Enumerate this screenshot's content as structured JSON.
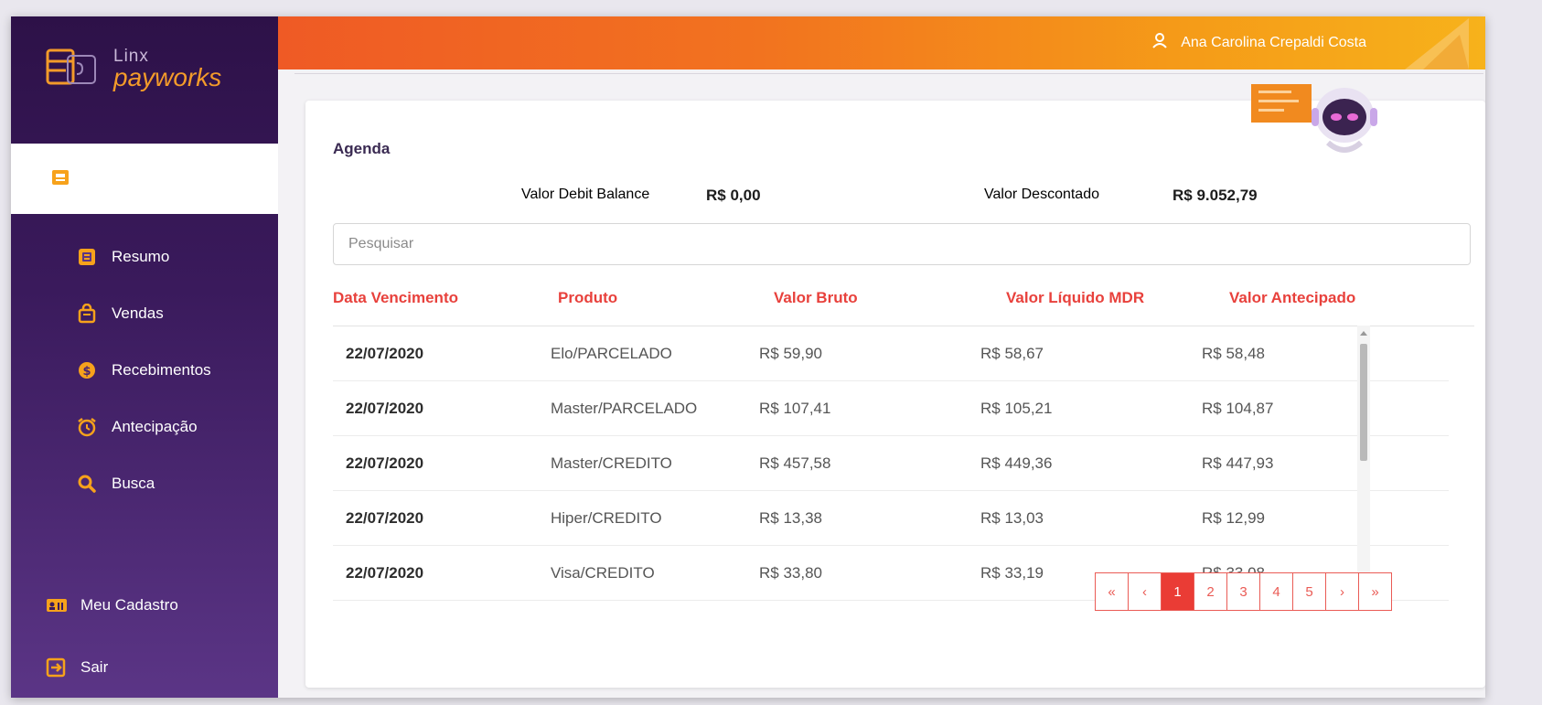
{
  "app": {
    "logo_top": "Linx",
    "logo_bottom": "payworks"
  },
  "header": {
    "user_name": "Ana Carolina Crepaldi Costa"
  },
  "sidebar": {
    "items": [
      {
        "label": "Resumo",
        "icon": "resumo-icon"
      },
      {
        "label": "Vendas",
        "icon": "shopping-bag-icon"
      },
      {
        "label": "Recebimentos",
        "icon": "dollar-coin-icon"
      },
      {
        "label": "Antecipação",
        "icon": "alarm-clock-icon"
      },
      {
        "label": "Busca",
        "icon": "search-icon"
      }
    ],
    "bottom_items": [
      {
        "label": "Meu Cadastro",
        "icon": "id-card-icon"
      },
      {
        "label": "Sair",
        "icon": "logout-icon"
      }
    ]
  },
  "agenda": {
    "title": "Agenda",
    "debit_balance_label": "Valor Debit Balance",
    "debit_balance_value": "R$ 0,00",
    "descontado_label": "Valor Descontado",
    "descontado_value": "R$ 9.052,79",
    "search_placeholder": "Pesquisar"
  },
  "table": {
    "columns": [
      "Data Vencimento",
      "Produto",
      "Valor Bruto",
      "Valor Líquido MDR",
      "Valor Antecipado"
    ],
    "rows": [
      [
        "22/07/2020",
        "Elo/PARCELADO",
        "R$ 59,90",
        "R$ 58,67",
        "R$ 58,48"
      ],
      [
        "22/07/2020",
        "Master/PARCELADO",
        "R$ 107,41",
        "R$ 105,21",
        "R$ 104,87"
      ],
      [
        "22/07/2020",
        "Master/CREDITO",
        "R$ 457,58",
        "R$ 449,36",
        "R$ 447,93"
      ],
      [
        "22/07/2020",
        "Hiper/CREDITO",
        "R$ 13,38",
        "R$ 13,03",
        "R$ 12,99"
      ],
      [
        "22/07/2020",
        "Visa/CREDITO",
        "R$ 33,80",
        "R$ 33,19",
        "R$ 33,08"
      ]
    ]
  },
  "pagination": {
    "first": "«",
    "prev": "‹",
    "pages": [
      "1",
      "2",
      "3",
      "4",
      "5"
    ],
    "active_page": "1",
    "next": "›",
    "last": "»"
  },
  "colors": {
    "sidebar_top": "#2d1148",
    "sidebar_bottom": "#5b3586",
    "header_start": "#ef5a25",
    "header_end": "#f7b21b",
    "accent_red": "#e8413c",
    "accent_orange": "#f39b2a"
  }
}
